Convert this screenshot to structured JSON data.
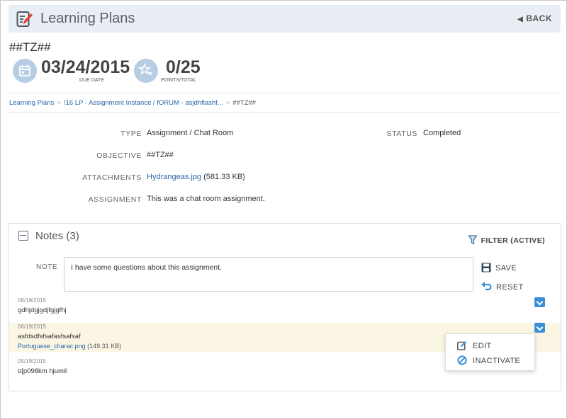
{
  "header": {
    "title": "Learning Plans",
    "back_label": "BACK",
    "icon": "edit-document-icon",
    "back_icon": "caret-left-icon"
  },
  "item": {
    "title": "##TZ##"
  },
  "stats": [
    {
      "value": "03/24/2015",
      "label": "DUE DATE",
      "icon": "calendar-icon"
    },
    {
      "value": "0/25",
      "label": "POINTS/TOTAL",
      "icon": "stars-icon"
    }
  ],
  "breadcrumb": {
    "items": [
      "Learning Plans",
      "!16 LP - Assignment Instance / fORUM - asjdhflashf..."
    ],
    "current": "##TZ##",
    "separator": ">"
  },
  "details": {
    "type_label": "TYPE",
    "type_value": "Assignment / Chat Room",
    "status_label": "STATUS",
    "status_value": "Completed",
    "objective_label": "OBJECTIVE",
    "objective_value": "##TZ##",
    "attachments_label": "ATTACHMENTS",
    "attachment_name": "Hydrangeas.jpg",
    "attachment_size": "(581.33 KB)",
    "assignment_label": "ASSIGNMENT",
    "assignment_value": "This was a chat room assignment."
  },
  "notes": {
    "title": "Notes (3)",
    "filter_label": "FILTER (ACTIVE)",
    "note_label": "NOTE",
    "note_value": "I have some questions about this assignment.",
    "save_label": "SAVE",
    "reset_label": "RESET",
    "items": [
      {
        "date": "06/19/2015",
        "text": "gdhjdgjgdjfgjgfhj"
      },
      {
        "date": "06/19/2015",
        "text": "asfdsdfsfsafasfsafsaf",
        "attachment_name": "Portuguese_charac.png",
        "attachment_size": "(149.31 KB)"
      },
      {
        "date": "05/19/2015",
        "text": "o[p098km hjumil"
      }
    ],
    "menu": {
      "edit_label": "EDIT",
      "inactivate_label": "INACTIVATE"
    }
  },
  "colors": {
    "accent": "#3a8fd6",
    "link": "#2a66a8",
    "header_bg": "#e9eef5",
    "highlight_row": "#fbf6e4"
  }
}
